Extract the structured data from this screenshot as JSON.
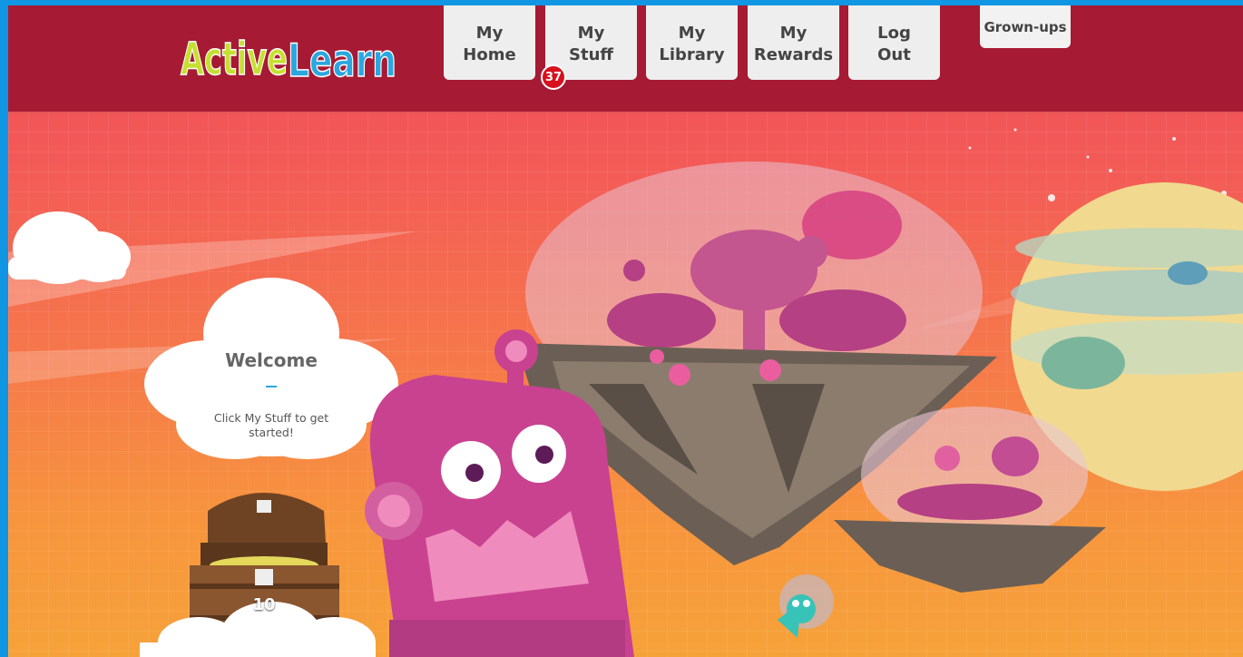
{
  "header": {
    "logo_text": "ActiveLearn",
    "nav": [
      {
        "line1": "My",
        "line2": "Home"
      },
      {
        "line1": "My",
        "line2": "Stuff"
      },
      {
        "line1": "My",
        "line2": "Library"
      },
      {
        "line1": "My",
        "line2": "Rewards"
      },
      {
        "line1": "Log",
        "line2": "Out"
      }
    ],
    "grownups_label": "Grown-ups",
    "stuff_badge_count": "37"
  },
  "welcome": {
    "title": "Welcome",
    "message": "Click My Stuff to get started!"
  },
  "chest": {
    "count": "10"
  },
  "colors": {
    "header_bg": "#a61a33",
    "page_border": "#1196e3",
    "badge": "#d8111f",
    "robot_pink": "#c9428f",
    "logo_green": "#c6e031",
    "logo_blue": "#2ba7e0"
  }
}
